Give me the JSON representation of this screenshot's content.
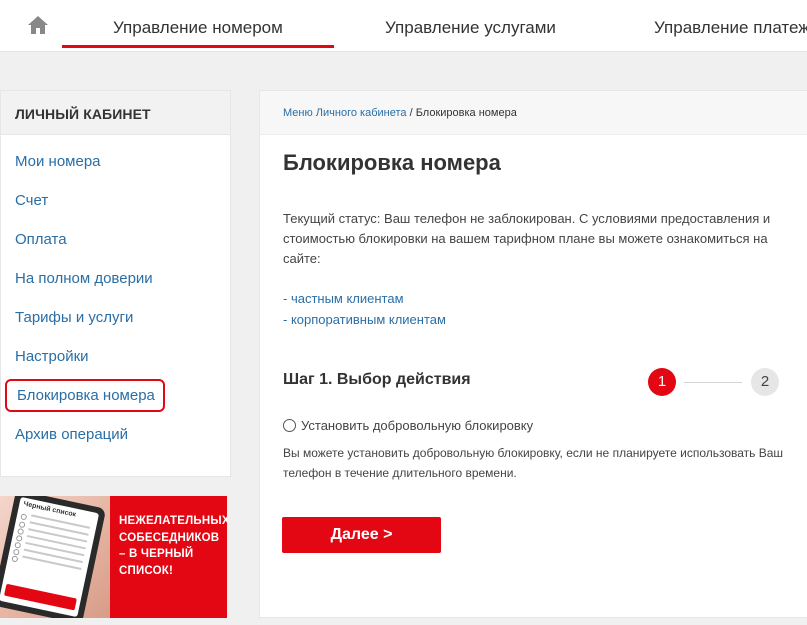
{
  "topnav": {
    "home_icon": "home-icon",
    "tabs": [
      {
        "label": "Управление номером",
        "active": true
      },
      {
        "label": "Управление услугами"
      },
      {
        "label": "Управление платеж"
      }
    ]
  },
  "sidebar": {
    "heading": "ЛИЧНЫЙ КАБИНЕТ",
    "items": [
      {
        "label": "Мои номера"
      },
      {
        "label": "Счет"
      },
      {
        "label": "Оплата"
      },
      {
        "label": "На полном доверии"
      },
      {
        "label": "Тарифы и услуги"
      },
      {
        "label": "Настройки"
      },
      {
        "label": "Блокировка номера",
        "active": true
      },
      {
        "label": "Архив операций"
      }
    ]
  },
  "banner": {
    "phone_title": "Черный список",
    "text": "НЕЖЕЛАТЕЛЬНЫХ СОБЕСЕДНИКОВ – В ЧЕРНЫЙ СПИСОК!"
  },
  "breadcrumb": {
    "root": "Меню Личного кабинета",
    "separator": "/",
    "current": "Блокировка номера"
  },
  "main": {
    "title": "Блокировка номера",
    "status_text": "Текущий статус: Ваш телефон не заблокирован. С условиями предоставления и стоимостью блокировки на вашем тарифном плане вы можете ознакомиться на сайте:",
    "links": [
      "- частным клиентам",
      "- корпоративным клиентам"
    ],
    "step_title": "Шаг 1. Выбор действия",
    "steps": [
      "1",
      "2"
    ],
    "current_step": 1,
    "option_label": "Установить добровольную блокировку",
    "option_desc": "Вы можете установить добровольную блокировку, если не планируете использовать Ваш телефон в течение длительного времени.",
    "next_button": "Далее >"
  },
  "colors": {
    "accent": "#e30613",
    "link": "#2a6ea6"
  }
}
